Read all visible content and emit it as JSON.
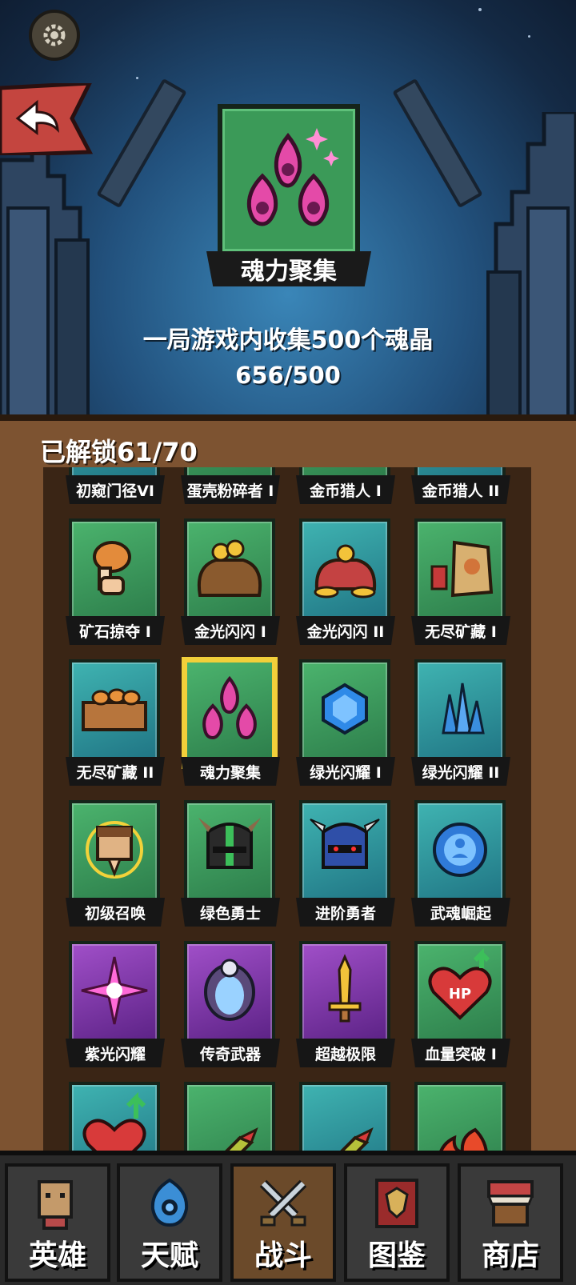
{
  "hero": {
    "badge_name": "魂力聚集",
    "description": "一局游戏内收集500个魂晶",
    "progress": "656/500"
  },
  "panel": {
    "unlocked_label": "已解锁",
    "unlocked_count": "61/70"
  },
  "achievements": [
    {
      "label": "初窥门径VI",
      "color": "teal"
    },
    {
      "label": "蛋壳粉碎者 I",
      "color": "green"
    },
    {
      "label": "金币猎人 I",
      "color": "green"
    },
    {
      "label": "金币猎人 II",
      "color": "teal"
    },
    {
      "label": "矿石掠夺 I",
      "color": "green",
      "icon": "drumstick-icon"
    },
    {
      "label": "金光闪闪 I",
      "color": "green",
      "icon": "gold-bag-icon"
    },
    {
      "label": "金光闪闪 II",
      "color": "teal",
      "icon": "gold-pile-icon"
    },
    {
      "label": "无尽矿藏 I",
      "color": "green",
      "icon": "loot-sack-icon"
    },
    {
      "label": "无尽矿藏 II",
      "color": "teal",
      "icon": "food-crate-icon"
    },
    {
      "label": "魂力聚集",
      "color": "green",
      "icon": "soul-flame-icon",
      "selected": true
    },
    {
      "label": "绿光闪耀 I",
      "color": "green",
      "icon": "blue-gem-icon"
    },
    {
      "label": "绿光闪耀 II",
      "color": "teal",
      "icon": "crystal-cluster-icon"
    },
    {
      "label": "初级召唤",
      "color": "green",
      "icon": "praying-hero-icon"
    },
    {
      "label": "绿色勇士",
      "color": "green",
      "icon": "green-helmet-icon"
    },
    {
      "label": "进阶勇者",
      "color": "teal",
      "icon": "blue-helmet-icon"
    },
    {
      "label": "武魂崛起",
      "color": "teal",
      "icon": "spirit-orb-icon"
    },
    {
      "label": "紫光闪耀",
      "color": "purple",
      "icon": "purple-star-icon"
    },
    {
      "label": "传奇武器",
      "color": "purple",
      "icon": "skull-shield-icon"
    },
    {
      "label": "超越极限",
      "color": "purple",
      "icon": "golden-sword-icon"
    },
    {
      "label": "血量突破 I",
      "color": "green",
      "icon": "hp-heart-icon"
    },
    {
      "label": "",
      "color": "teal",
      "icon": "heart-up-icon"
    },
    {
      "label": "",
      "color": "green",
      "icon": "rocket-icon"
    },
    {
      "label": "",
      "color": "teal",
      "icon": "rocket-icon"
    },
    {
      "label": "",
      "color": "green",
      "icon": "fire-icon"
    }
  ],
  "hp_text": "HP",
  "nav": {
    "tabs": [
      {
        "label": "英雄",
        "icon": "hero-icon"
      },
      {
        "label": "天赋",
        "icon": "talent-icon"
      },
      {
        "label": "战斗",
        "icon": "crossed-swords-icon",
        "active": true
      },
      {
        "label": "图鉴",
        "icon": "codex-icon"
      },
      {
        "label": "商店",
        "icon": "shop-icon"
      }
    ]
  }
}
